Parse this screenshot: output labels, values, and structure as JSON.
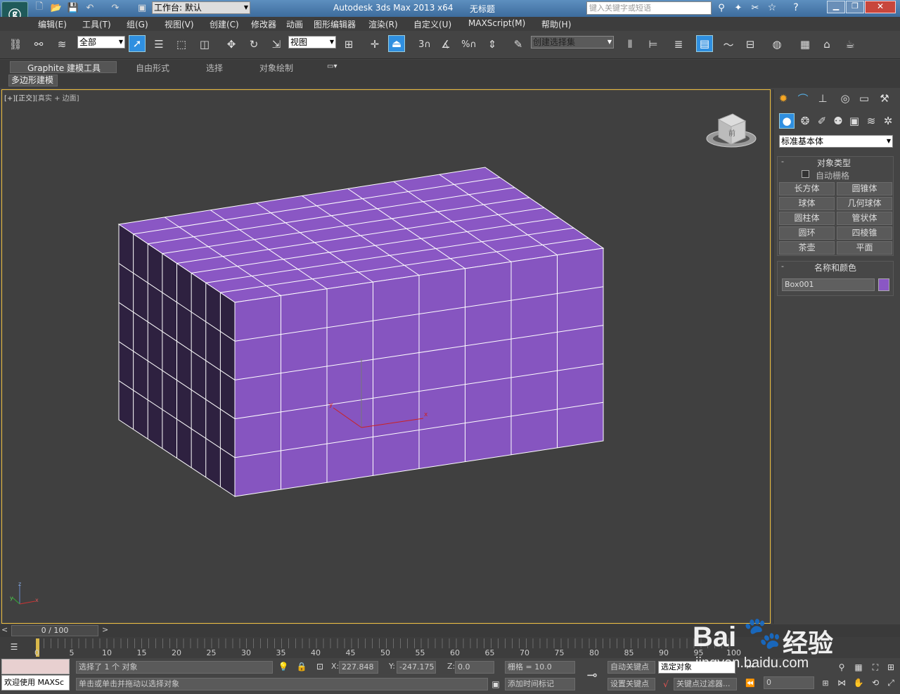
{
  "window": {
    "app_title": "Autodesk 3ds Max  2013 x64",
    "doc_title": "无标题",
    "workspace": "工作台: 默认",
    "search_placeholder": "键入关键字或短语"
  },
  "menu": [
    "编辑(E)",
    "工具(T)",
    "组(G)",
    "视图(V)",
    "创建(C)",
    "修改器",
    "动画",
    "图形编辑器",
    "渲染(R)",
    "自定义(U)",
    "MAXScript(M)",
    "帮助(H)"
  ],
  "toolbar": {
    "filter_value": "全部",
    "ref_coord_value": "视图",
    "named_sel_placeholder": "创建选择集",
    "snap_labels": [
      "3",
      "%"
    ]
  },
  "ribbon": {
    "tabs": [
      "Graphite 建模工具",
      "自由形式",
      "选择",
      "对象绘制"
    ],
    "sub_label": "多边形建模"
  },
  "viewport": {
    "label_plus": "[+]",
    "label_view": "[正交]",
    "label_shading": "[真实 + 边面]",
    "viewcube_text": "前",
    "axis_labels": [
      "z",
      "y",
      "x"
    ]
  },
  "command_panel": {
    "category": "标准基本体",
    "section_object_type": "对象类型",
    "autogrid_label": "自动栅格",
    "buttons": [
      "长方体",
      "圆锥体",
      "球体",
      "几何球体",
      "圆柱体",
      "管状体",
      "圆环",
      "四棱锥",
      "茶壶",
      "平面"
    ],
    "section_name_color": "名称和颜色",
    "object_name": "Box001",
    "object_color": "#8a57c4"
  },
  "timeline": {
    "frame_display": "0 / 100",
    "ticks": [
      "0",
      "5",
      "10",
      "15",
      "20",
      "25",
      "30",
      "35",
      "40",
      "45",
      "50",
      "55",
      "60",
      "65",
      "70",
      "75",
      "80",
      "85",
      "90",
      "95",
      "100"
    ]
  },
  "status": {
    "welcome": "欢迎使用 MAXSc",
    "selection_info": "选择了 1 个 对象",
    "prompt": "单击或单击并拖动以选择对象",
    "x_label": "X:",
    "x_value": "227.848",
    "y_label": "Y:",
    "y_value": "-247.175",
    "z_label": "Z:",
    "z_value": "0.0",
    "grid": "栅格 = 10.0",
    "add_time_tag": "添加时间标记",
    "auto_key": "自动关键点",
    "set_key": "设置关键点",
    "selected_obj": "选定对象",
    "key_filter": "关键点过滤器...",
    "frame_value": "0"
  },
  "watermark": {
    "brand": "Bai",
    "brand2": "经验",
    "url": "jingyan.baidu.com"
  }
}
